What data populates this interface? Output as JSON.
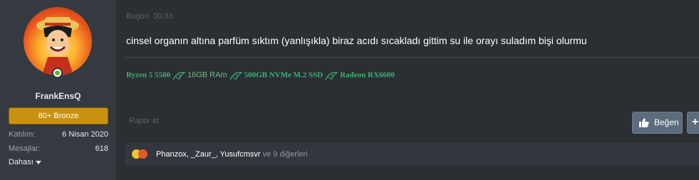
{
  "user": {
    "username": "FrankEnsQ",
    "rank_badge": "80+ Bronze",
    "stats": [
      {
        "label": "Katılım:",
        "value": "6 Nisan 2020"
      },
      {
        "label": "Mesajlar:",
        "value": "618"
      }
    ],
    "more_label": "Dahası",
    "online": true
  },
  "post": {
    "date": "Bugün, 00:33",
    "message": "cinsel organın altına parfüm sıktım (yanlışıkla) biraz acıdı sıcakladı gittim su ile orayı suladım bişi olurmu",
    "signature": {
      "cpu": "Ryzen 5 5500",
      "ram": "16GB RAm",
      "storage": "500GB NVMe M.2 SSD",
      "gpu": "Radeon RX6600",
      "color": "#3cb371"
    },
    "report_label": "Rapor et",
    "like_label": "Beğen",
    "plus_label": "+"
  },
  "reactions": {
    "users_text": "Phanzox, _Zaur_, Yusufcmsvr",
    "others_text": "ve 9 diğerleri",
    "emoji_icons": [
      "laughing-emoji-icon",
      "angry-emoji-icon"
    ]
  }
}
